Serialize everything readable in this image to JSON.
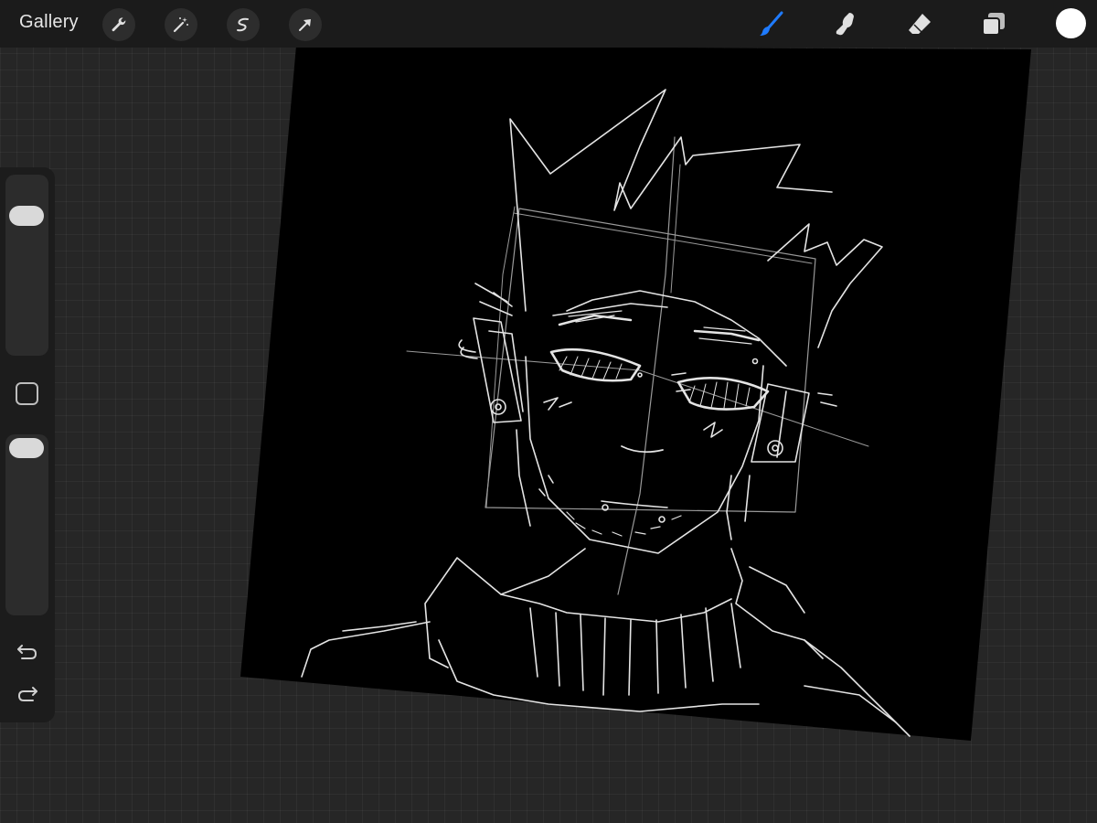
{
  "toolbar": {
    "gallery_label": "Gallery",
    "left_tools": [
      "wrench-icon",
      "magic-wand-icon",
      "selection-icon",
      "transform-arrow-icon"
    ],
    "right_tools": [
      "brush-icon",
      "smudge-icon",
      "eraser-icon",
      "layers-icon"
    ],
    "active_tool": "brush-icon",
    "accent_color": "#1f7bff",
    "current_color": "#ffffff"
  },
  "sidebar": {
    "brush_size_level": 0.82,
    "opacity_level": 1.0,
    "controls": [
      "brush-size-slider",
      "modify-button",
      "opacity-slider",
      "undo-icon",
      "redo-icon"
    ]
  },
  "canvas": {
    "background_color": "#000000",
    "stroke_color": "#e8e8e8",
    "content": "sketch"
  }
}
